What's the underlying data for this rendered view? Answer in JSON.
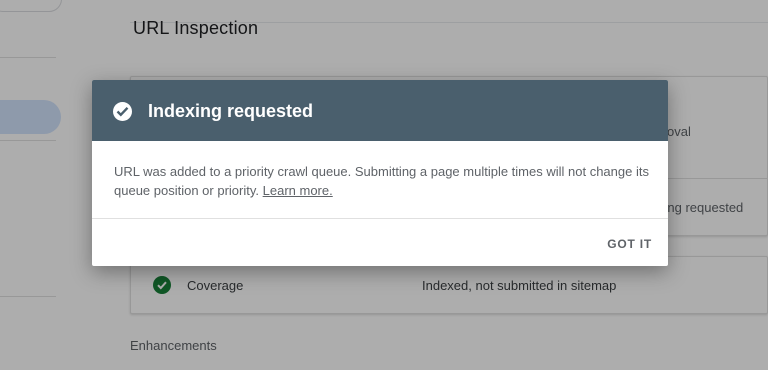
{
  "page": {
    "title": "URL Inspection",
    "bg_rows": {
      "removal_fragment": "oval",
      "indexing_fragment": "xing requested"
    },
    "coverage": {
      "label": "Coverage",
      "value": "Indexed, not submitted in sitemap"
    },
    "enhancements_label": "Enhancements"
  },
  "dialog": {
    "title": "Indexing requested",
    "body_text": "URL was added to a priority crawl queue. Submitting a page multiple times will not change its queue position or priority.",
    "learn_more": "Learn more.",
    "confirm_button": "GOT IT"
  },
  "colors": {
    "header_bg": "#4a5f6d",
    "success_green": "#188038",
    "scrim": "rgba(0,0,0,0.32)"
  },
  "icons": {
    "dialog_status": "check-circle-icon",
    "coverage_status": "check-circle-icon"
  }
}
